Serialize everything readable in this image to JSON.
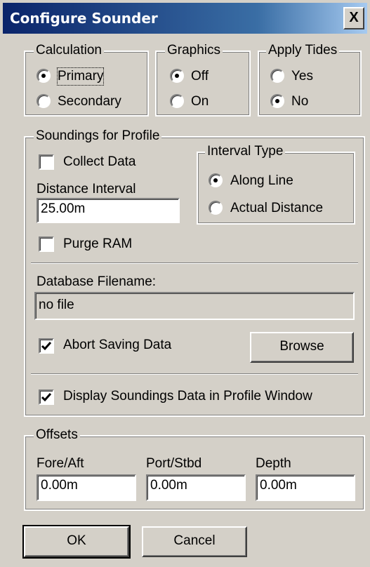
{
  "window": {
    "title": "Configure Sounder",
    "close_glyph": "X"
  },
  "calculation": {
    "legend": "Calculation",
    "options": [
      "Primary",
      "Secondary"
    ],
    "selected": "Primary"
  },
  "graphics": {
    "legend": "Graphics",
    "options": [
      "Off",
      "On"
    ],
    "selected": "Off"
  },
  "tides": {
    "legend": "Apply Tides",
    "options": [
      "Yes",
      "No"
    ],
    "selected": "No"
  },
  "soundings": {
    "legend": "Soundings for Profile",
    "collect_data": {
      "label": "Collect Data",
      "checked": false
    },
    "distance_interval_label": "Distance Interval",
    "distance_interval_value": "25.00m",
    "purge_ram": {
      "label": "Purge RAM",
      "checked": false
    },
    "interval_type": {
      "legend": "Interval Type",
      "options": [
        "Along Line",
        "Actual Distance"
      ],
      "selected": "Along Line"
    },
    "database_label": "Database Filename:",
    "database_value": "no file",
    "abort_saving": {
      "label": "Abort Saving Data",
      "checked": true
    },
    "browse_label": "Browse",
    "display_soundings": {
      "label": "Display Soundings Data in Profile Window",
      "checked": true
    }
  },
  "offsets": {
    "legend": "Offsets",
    "fields": [
      {
        "label": "Fore/Aft",
        "value": "0.00m"
      },
      {
        "label": "Port/Stbd",
        "value": "0.00m"
      },
      {
        "label": "Depth",
        "value": "0.00m"
      }
    ]
  },
  "buttons": {
    "ok": "OK",
    "cancel": "Cancel"
  },
  "colors": {
    "dialog_face": "#d4d0c8",
    "titlebar_start": "#0a246a",
    "titlebar_end": "#a6caf0"
  }
}
